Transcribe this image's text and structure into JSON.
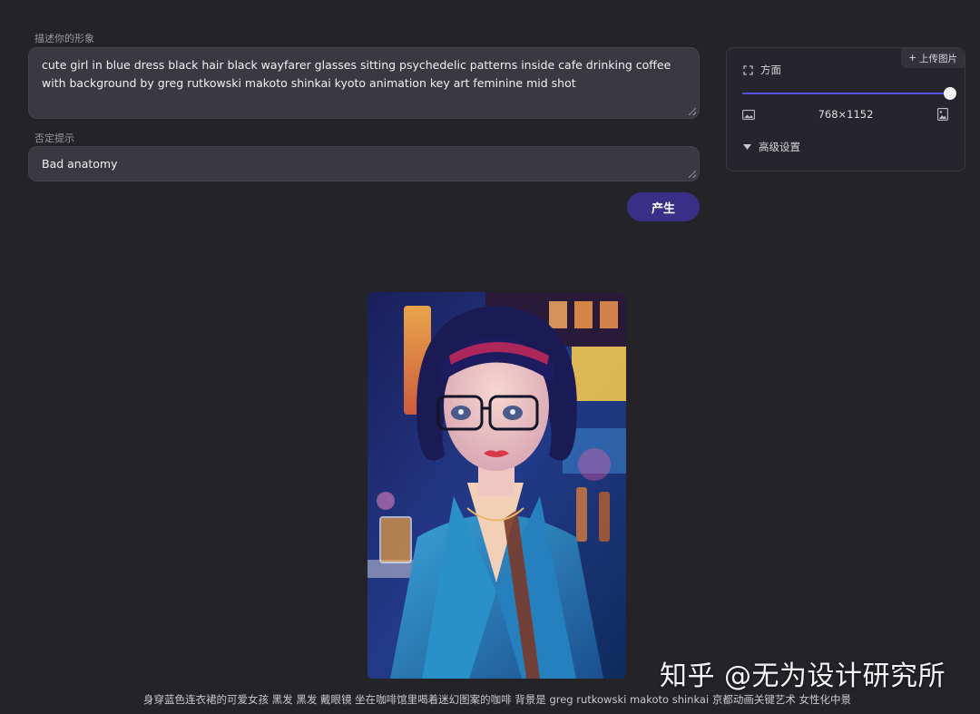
{
  "prompt": {
    "label": "描述你的形象",
    "value": "cute girl in blue dress black hair black wayfarer glasses sitting psychedelic patterns inside cafe drinking coffee with background by greg rutkowski makoto shinkai kyoto animation key art feminine mid shot"
  },
  "negative": {
    "label": "否定提示",
    "value": "Bad anatomy"
  },
  "generate_label": "产生",
  "settings": {
    "upload_label": "上传图片",
    "upload_plus": "+",
    "aspect_label": "方面",
    "aspect_slider_fraction": 1.0,
    "dimensions": "768×1152",
    "advanced_label": "高级设置"
  },
  "output": {
    "caption": "身穿蓝色连衣裙的可爱女孩 黑发 黑发 戴眼镜 坐在咖啡馆里喝着迷幻图案的咖啡 背景是 greg rutkowski makoto shinkai 京都动画关键艺术 女性化中景"
  },
  "watermark": "知乎 @无为设计研究所",
  "colors": {
    "background": "#242328",
    "input_bg": "#3a3940",
    "accent": "#3a2f86",
    "slider_accent": "#5a4fe0"
  }
}
